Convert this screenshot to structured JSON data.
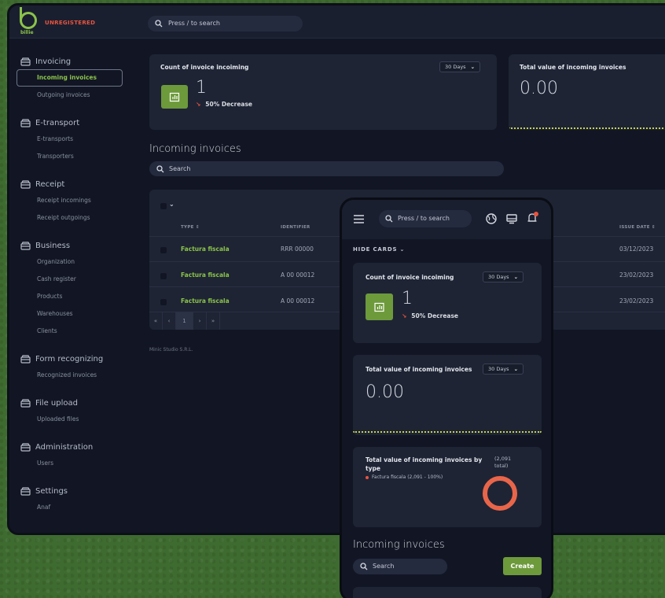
{
  "app": {
    "brand": "billie",
    "license_status": "UNREGISTERED",
    "search_placeholder": "Press / to search",
    "footer": "Minic Studio S.R.L."
  },
  "sidebar": {
    "groups": [
      {
        "title": "Invoicing",
        "items": [
          "Incoming invoices",
          "Outgoing invoices"
        ],
        "active": "Incoming invoices"
      },
      {
        "title": "E-transport",
        "items": [
          "E-transports",
          "Transporters"
        ]
      },
      {
        "title": "Receipt",
        "items": [
          "Receipt incomings",
          "Receipt outgoings"
        ]
      },
      {
        "title": "Business",
        "items": [
          "Organization",
          "Cash register",
          "Products",
          "Warehouses",
          "Clients"
        ]
      },
      {
        "title": "Form recognizing",
        "items": [
          "Recognized invoices"
        ]
      },
      {
        "title": "File upload",
        "items": [
          "Uploaded files"
        ]
      },
      {
        "title": "Administration",
        "items": [
          "Users"
        ]
      },
      {
        "title": "Settings",
        "items": [
          "Anaf"
        ]
      }
    ]
  },
  "cards": {
    "count": {
      "title": "Count of invoice incoiming",
      "period": "30 Days",
      "value": "1",
      "change": "50% Decrease"
    },
    "total": {
      "title": "Total value of incoming invoices",
      "period": "30 Days",
      "value": "0.00"
    },
    "by_type": {
      "title": "Total value of incoming invoices by type",
      "total_note": "(2,091 total)",
      "legend": "Factura fiscala (2,091 - 100%)"
    }
  },
  "section": {
    "title": "Incoming invoices",
    "search_placeholder": "Search",
    "create_label": "Create"
  },
  "table": {
    "columns": {
      "type": "TYPE",
      "identifier": "IDENTIFIER",
      "issue_date": "ISSUE DATE"
    },
    "rows": [
      {
        "type": "Factura fiscala",
        "identifier": "RRR 00000",
        "issue_date": "03/12/2023"
      },
      {
        "type": "Factura fiscala",
        "identifier": "A 00 00012",
        "issue_date": "23/02/2023"
      },
      {
        "type": "Factura fiscala",
        "identifier": "A 00 00012",
        "issue_date": "23/02/2023"
      }
    ],
    "pager": {
      "first": "«",
      "prev": "‹",
      "current": "1",
      "next": "›",
      "last": "»"
    }
  },
  "phone": {
    "hide_cards": "HIDE CARDS"
  },
  "colors": {
    "accent": "#8bc34a",
    "danger": "#e8543f",
    "donut": "#e8654a"
  }
}
